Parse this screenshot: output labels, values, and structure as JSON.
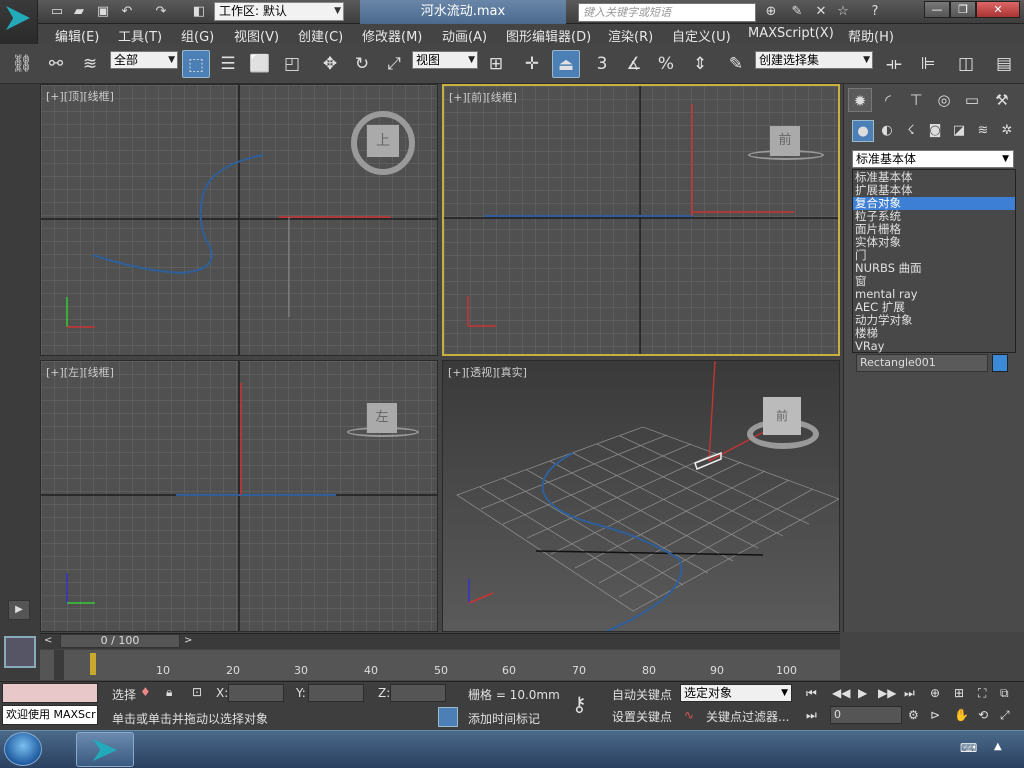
{
  "titlebar": {
    "workspace": "工作区: 默认",
    "window_title": "河水流动.max",
    "search_placeholder": "键入关键字或短语"
  },
  "menu": [
    "编辑(E)",
    "工具(T)",
    "组(G)",
    "视图(V)",
    "创建(C)",
    "修改器(M)",
    "动画(A)",
    "图形编辑器(D)",
    "渲染(R)",
    "自定义(U)",
    "MAXScript(X)",
    "帮助(H)"
  ],
  "toolbar": {
    "selection_filter": "全部",
    "ref_coord": "视图",
    "snap_label": "3",
    "named_selection": "创建选择集"
  },
  "viewports": {
    "top": {
      "label": "[+][顶][线框]",
      "cube_label": "上"
    },
    "front": {
      "label": "[+][前][线框]",
      "cube_label": "前"
    },
    "left": {
      "label": "[+][左][线框]",
      "cube_label": "左"
    },
    "persp": {
      "label": "[+][透视][真实]",
      "cube_label": "前"
    }
  },
  "command_panel": {
    "category_selected": "标准基本体",
    "category_options": [
      "标准基本体",
      "扩展基本体",
      "复合对象",
      "粒子系统",
      "面片栅格",
      "实体对象",
      "门",
      "NURBS 曲面",
      "窗",
      "mental ray",
      "AEC 扩展",
      "动力学对象",
      "楼梯",
      "VRay"
    ],
    "highlighted_option": "复合对象",
    "object_name": "Rectangle001",
    "object_color": "#3a8ad8"
  },
  "timeline": {
    "frame_display": "0 / 100",
    "ticks": [
      "10",
      "20",
      "30",
      "40",
      "50",
      "60",
      "70",
      "80",
      "90",
      "100"
    ]
  },
  "status": {
    "select_label": "选择",
    "x_label": "X:",
    "y_label": "Y:",
    "z_label": "Z:",
    "grid": "栅格 = 10.0mm",
    "auto_key": "自动关键点",
    "set_key": "设置关键点",
    "key_mode": "选定对象",
    "key_filters": "关键点过滤器...",
    "prompt": "单击或单击并拖动以选择对象",
    "add_time_tag": "添加时间标记",
    "welcome": "欢迎使用 MAXScr",
    "current_frame": "0"
  },
  "colors": {
    "accent": "#4b7fb6",
    "highlight": "#3d7fd4",
    "active_viewport": "#c8b040"
  }
}
